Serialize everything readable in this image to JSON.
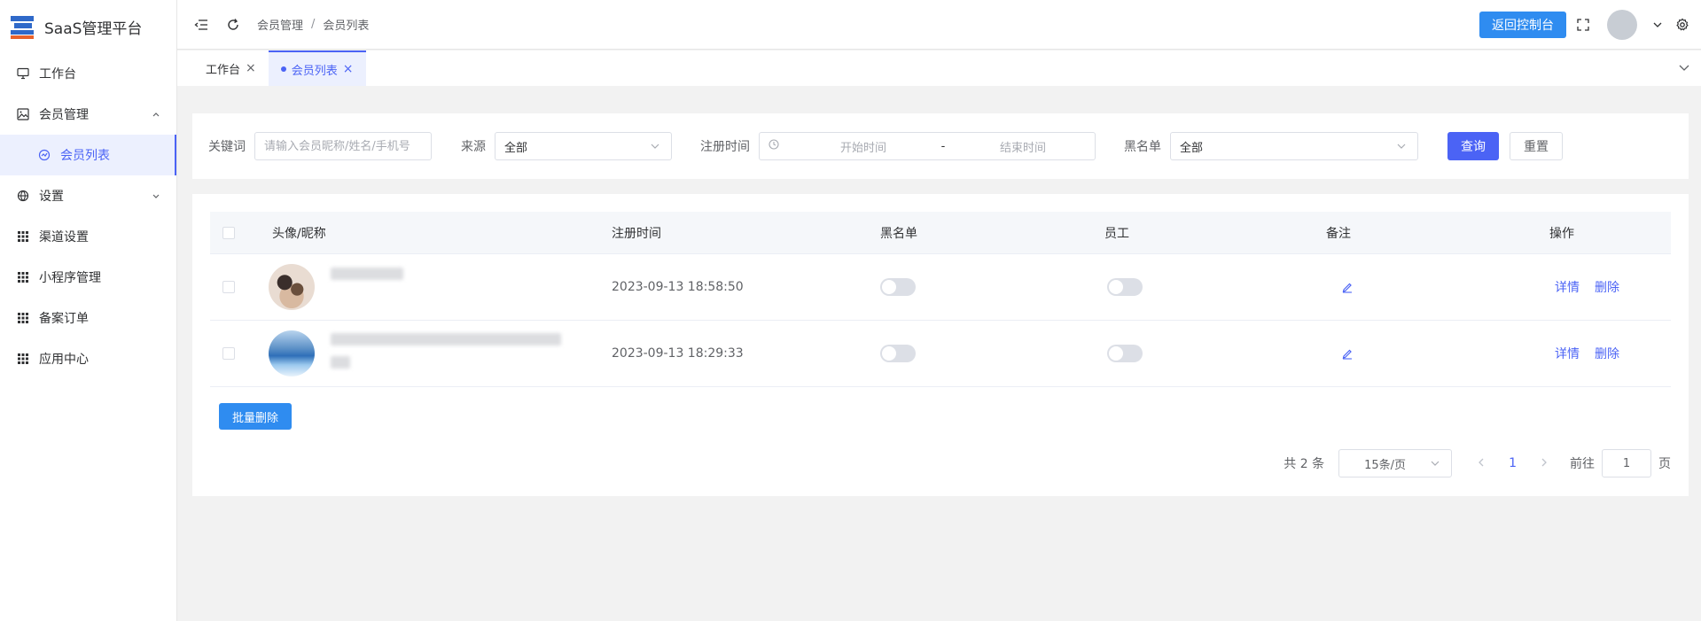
{
  "app": {
    "title": "SaaS管理平台"
  },
  "sidebar": {
    "items": [
      {
        "label": "工作台",
        "icon": "monitor-icon"
      },
      {
        "label": "会员管理",
        "icon": "image-icon",
        "expanded": true
      },
      {
        "label": "会员列表",
        "icon": "circle-gauge-icon",
        "active": true
      },
      {
        "label": "设置",
        "icon": "basketball-icon"
      },
      {
        "label": "渠道设置",
        "icon": "grid-icon"
      },
      {
        "label": "小程序管理",
        "icon": "grid-icon"
      },
      {
        "label": "备案订单",
        "icon": "grid-icon"
      },
      {
        "label": "应用中心",
        "icon": "grid-icon"
      }
    ]
  },
  "header": {
    "breadcrumb": [
      "会员管理",
      "会员列表"
    ],
    "breadcrumb_sep": "/",
    "console_button": "返回控制台"
  },
  "tabs": [
    {
      "label": "工作台",
      "active": false
    },
    {
      "label": "会员列表",
      "active": true
    }
  ],
  "filters": {
    "keyword_label": "关键词",
    "keyword_placeholder": "请输入会员昵称/姓名/手机号",
    "source_label": "来源",
    "source_value": "全部",
    "regtime_label": "注册时间",
    "start_placeholder": "开始时间",
    "range_sep": "-",
    "end_placeholder": "结束时间",
    "blacklist_label": "黑名单",
    "blacklist_value": "全部",
    "query_button": "查询",
    "reset_button": "重置"
  },
  "table": {
    "columns": [
      "头像/昵称",
      "注册时间",
      "黑名单",
      "员工",
      "备注",
      "操作"
    ],
    "rows": [
      {
        "reg_time": "2023-09-13 18:58:50",
        "blacklist": false,
        "staff": false
      },
      {
        "reg_time": "2023-09-13 18:29:33",
        "blacklist": false,
        "staff": false
      }
    ],
    "action_detail": "详情",
    "action_delete": "删除"
  },
  "batch_delete": "批量删除",
  "pagination": {
    "total_text": "共 2 条",
    "page_size": "15条/页",
    "current_page": "1",
    "goto_label": "前往",
    "goto_value": "1",
    "page_unit": "页"
  },
  "colors": {
    "primary": "#4b63f5",
    "accent_blue": "#2f8cf0",
    "sidebar_active_bg": "#ecf0fe"
  }
}
